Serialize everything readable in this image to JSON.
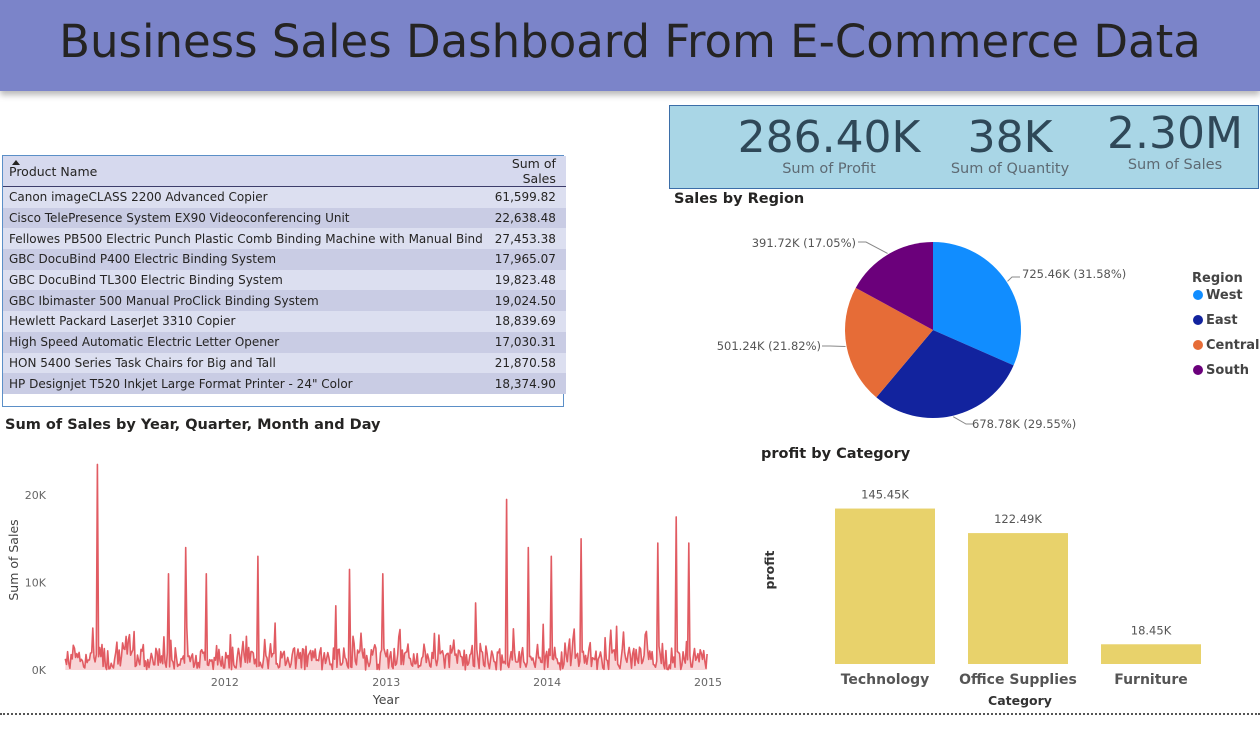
{
  "title": "Business Sales Dashboard From E-Commerce Data",
  "table": {
    "headers": [
      "Product Name",
      "Sum of Sales"
    ],
    "rows": [
      [
        "Canon imageCLASS 2200 Advanced Copier",
        "61,599.82"
      ],
      [
        "Cisco TelePresence System EX90 Videoconferencing Unit",
        "22,638.48"
      ],
      [
        "Fellowes PB500 Electric Punch Plastic Comb Binding Machine with Manual Bind",
        "27,453.38"
      ],
      [
        "GBC DocuBind P400 Electric Binding System",
        "17,965.07"
      ],
      [
        "GBC DocuBind TL300 Electric Binding System",
        "19,823.48"
      ],
      [
        "GBC Ibimaster 500 Manual ProClick Binding System",
        "19,024.50"
      ],
      [
        "Hewlett Packard LaserJet 3310 Copier",
        "18,839.69"
      ],
      [
        "High Speed Automatic Electric Letter Opener",
        "17,030.31"
      ],
      [
        "HON 5400 Series Task Chairs for Big and Tall",
        "21,870.58"
      ],
      [
        "HP Designjet T520 Inkjet Large Format Printer - 24\" Color",
        "18,374.90"
      ]
    ]
  },
  "kpis": [
    {
      "value": "286.40K",
      "label": "Sum of Profit"
    },
    {
      "value": "38K",
      "label": "Sum of Quantity"
    },
    {
      "value": "2.30M",
      "label": "Sum of Sales"
    }
  ],
  "chart_data": [
    {
      "type": "pie",
      "title": "Sales by Region",
      "legend_title": "Region",
      "legend_position": "right",
      "categories": [
        "West",
        "East",
        "Central",
        "South"
      ],
      "values": [
        725.46,
        678.78,
        501.24,
        391.72
      ],
      "percents": [
        31.58,
        29.55,
        21.82,
        17.05
      ],
      "labels": [
        "725.46K (31.58%)",
        "678.78K (29.55%)",
        "501.24K (21.82%)",
        "391.72K (17.05%)"
      ],
      "colors": [
        "#118dff",
        "#12239e",
        "#e66c37",
        "#6b007b"
      ]
    },
    {
      "type": "area",
      "title": "Sum of Sales by Year, Quarter, Month and Day",
      "xlabel": "Year",
      "ylabel": "Sum of Sales",
      "x_ticks": [
        "2012",
        "2013",
        "2014",
        "2015"
      ],
      "y_ticks": [
        "0K",
        "10K",
        "20K"
      ],
      "ylim": [
        0,
        24000
      ],
      "xlim": [
        "2011-01-01",
        "2015-01-01"
      ],
      "peaks": [
        {
          "date": "2011-03-18",
          "value": 23500
        },
        {
          "date": "2011-08-25",
          "value": 11000
        },
        {
          "date": "2011-10-05",
          "value": 14000
        },
        {
          "date": "2011-11-20",
          "value": 11000
        },
        {
          "date": "2012-03-15",
          "value": 13000
        },
        {
          "date": "2012-10-10",
          "value": 11500
        },
        {
          "date": "2012-12-25",
          "value": 11000
        },
        {
          "date": "2013-10-01",
          "value": 19500
        },
        {
          "date": "2013-11-20",
          "value": 14000
        },
        {
          "date": "2014-01-10",
          "value": 13000
        },
        {
          "date": "2014-03-20",
          "value": 15000
        },
        {
          "date": "2014-09-08",
          "value": 14500
        },
        {
          "date": "2014-10-20",
          "value": 17500
        },
        {
          "date": "2014-11-18",
          "value": 14500
        }
      ],
      "colors": {
        "line": "#e15b62",
        "fill": "#f3b3b6"
      }
    },
    {
      "type": "bar",
      "title": "profit by Category",
      "xlabel": "Category",
      "ylabel": "profit",
      "categories": [
        "Technology",
        "Office Supplies",
        "Furniture"
      ],
      "values": [
        145.45,
        122.49,
        18.45
      ],
      "labels": [
        "145.45K",
        "122.49K",
        "18.45K"
      ],
      "ylim": [
        0,
        160
      ],
      "colors": {
        "bar": "#e8d26b"
      }
    }
  ]
}
